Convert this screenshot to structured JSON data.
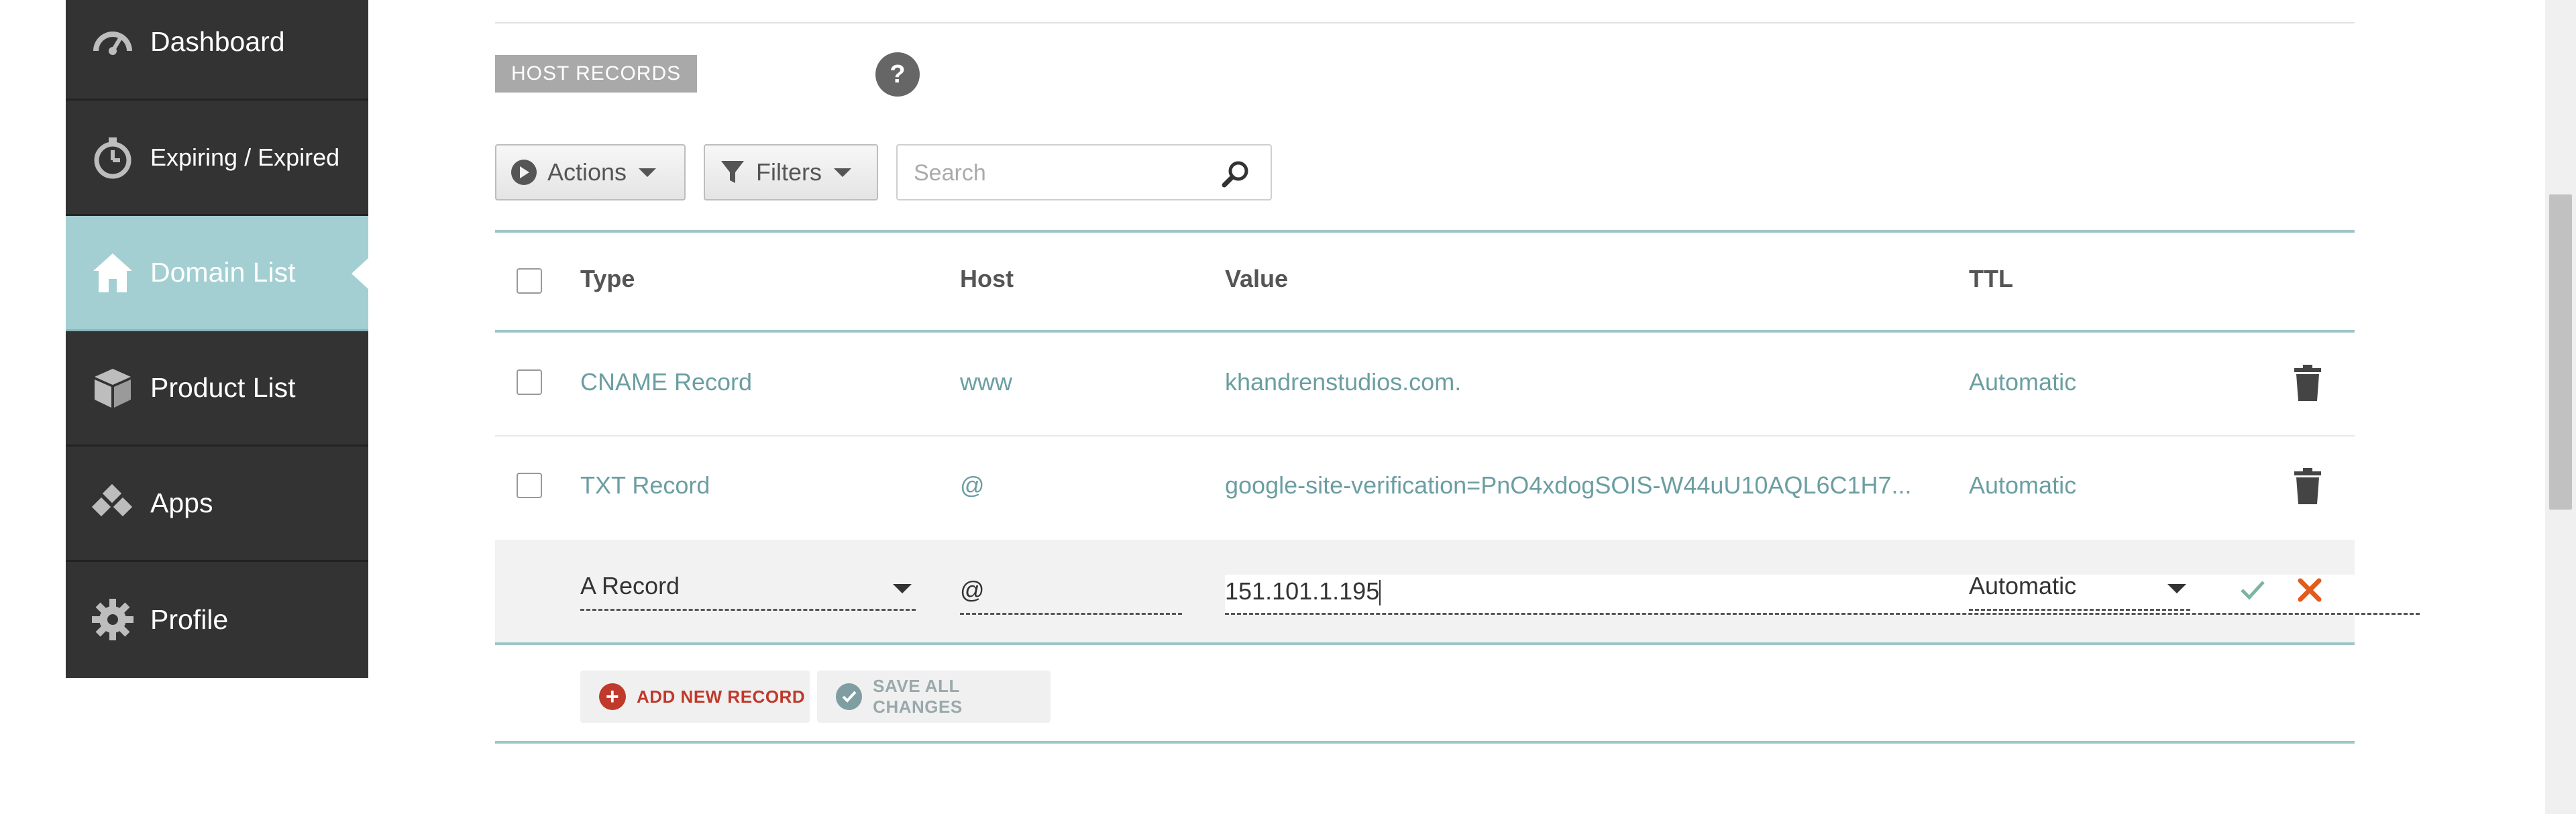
{
  "sidebar": {
    "items": [
      {
        "label": "Dashboard",
        "icon": "dashboard-icon"
      },
      {
        "label": "Expiring / Expired",
        "icon": "stopwatch-icon"
      },
      {
        "label": "Domain List",
        "icon": "home-icon",
        "active": true
      },
      {
        "label": "Product List",
        "icon": "box-icon"
      },
      {
        "label": "Apps",
        "icon": "apps-icon"
      },
      {
        "label": "Profile",
        "icon": "gear-icon"
      }
    ]
  },
  "section": {
    "title": "HOST RECORDS",
    "help": "?"
  },
  "toolbar": {
    "actions_label": "Actions",
    "filters_label": "Filters",
    "search_placeholder": "Search"
  },
  "table": {
    "columns": {
      "type": "Type",
      "host": "Host",
      "value": "Value",
      "ttl": "TTL"
    },
    "rows": [
      {
        "type": "CNAME Record",
        "host": "www",
        "value": "khandrenstudios.com.",
        "ttl": "Automatic"
      },
      {
        "type": "TXT Record",
        "host": "@",
        "value": "google-site-verification=PnO4xdogSOIS-W44uU10AQL6C1H7...",
        "ttl": "Automatic"
      }
    ],
    "edit_row": {
      "type": "A Record",
      "host": "@",
      "value": "151.101.1.195",
      "ttl": "Automatic"
    }
  },
  "footer_actions": {
    "add_label": "ADD NEW RECORD",
    "save_label": "SAVE ALL CHANGES"
  },
  "colors": {
    "sidebar_bg": "#333333",
    "active_nav": "#a3cfd2",
    "teal_rule": "#9fc5c8",
    "cell_text": "#6b9ea2",
    "add_red": "#c0392b",
    "cancel_orange": "#e25a1c"
  }
}
